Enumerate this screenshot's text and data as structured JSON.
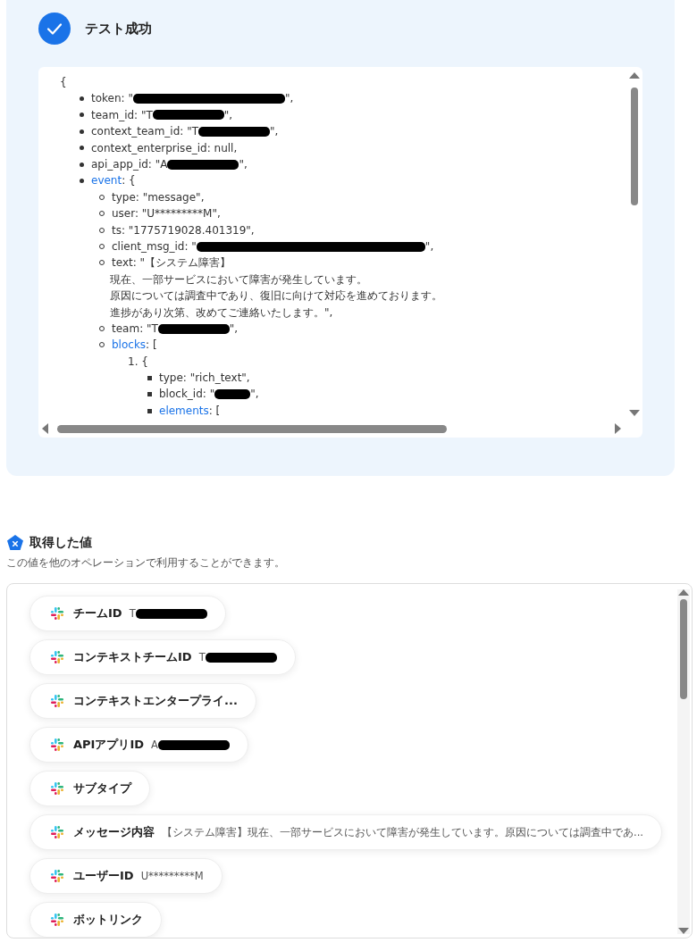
{
  "test_result": {
    "title": "テスト成功",
    "success": true,
    "code_view": {
      "open": "{",
      "list": {
        "kind": "disc",
        "items": [
          {
            "key": "token: \"",
            "link": false,
            "kind": "secret_long",
            "after": "\","
          },
          {
            "key": "team_id: \"T",
            "link": false,
            "kind": "secret",
            "after": "\","
          },
          {
            "key": "context_team_id: \"T",
            "link": false,
            "kind": "secret",
            "after": "\","
          },
          {
            "key": "context_enterprise_id: null,",
            "link": false,
            "kind": "plain"
          },
          {
            "key": "api_app_id: \"A",
            "link": false,
            "kind": "secret",
            "after": "\","
          },
          {
            "key": "event",
            "link": true,
            "kind": "plain",
            "after": ": {",
            "list": {
              "kind": "circle",
              "items": [
                {
                  "key": "type: \"message\",",
                  "link": false,
                  "kind": "plain"
                },
                {
                  "key": "user: \"U*********M\",",
                  "link": false,
                  "kind": "plain"
                },
                {
                  "key": "ts: \"1775719028.401319\",",
                  "link": false,
                  "kind": "plain"
                },
                {
                  "key": "client_msg_id: \"",
                  "link": false,
                  "kind": "secret_xlong",
                  "after": "\","
                },
                {
                  "key": "text: \"【システム障害】",
                  "link": false,
                  "kind": "plain",
                  "continuation": [
                    "現在、一部サービスにおいて障害が発生しています。",
                    "原因については調査中であり、復旧に向けて対応を進めております。",
                    "進捗があり次第、改めてご連絡いたします。\","
                  ]
                },
                {
                  "key": "team: \"T",
                  "link": false,
                  "kind": "secret",
                  "after": "\","
                },
                {
                  "key": "blocks",
                  "link": true,
                  "kind": "plain",
                  "after": ": [",
                  "list": {
                    "kind": "numbered",
                    "items": [
                      {
                        "key": "1. {",
                        "link": false,
                        "list": {
                          "kind": "square",
                          "items": [
                            {
                              "key": "type: \"rich_text\",",
                              "link": false,
                              "kind": "plain"
                            },
                            {
                              "key": "block_id: \"",
                              "link": false,
                              "kind": "secret_short",
                              "after": "\","
                            },
                            {
                              "key": "elements",
                              "link": true,
                              "kind": "plain",
                              "after": ": ["
                            }
                          ]
                        }
                      }
                    ]
                  }
                }
              ]
            }
          }
        ]
      }
    }
  },
  "values_section": {
    "title": "取得した値",
    "description": "この値を他のオペレーションで利用することができます。",
    "items": [
      {
        "label": "チームID",
        "value": "T",
        "kind": "secret"
      },
      {
        "label": "コンテキストチームID",
        "value": "T",
        "kind": "secret"
      },
      {
        "label": "コンテキストエンタープライ...",
        "kind": "plain"
      },
      {
        "label": "APIアプリID",
        "value": "A",
        "kind": "secret"
      },
      {
        "label": "サブタイプ",
        "kind": "plain"
      },
      {
        "label": "メッセージ内容",
        "value": "【システム障害】現在、一部サービスにおいて障害が発生しています。原因については調査中であ...",
        "kind": "plain"
      },
      {
        "label": "ユーザーID",
        "value": "U*********M",
        "kind": "plain"
      },
      {
        "label": "ボットリンク",
        "kind": "plain"
      }
    ]
  }
}
